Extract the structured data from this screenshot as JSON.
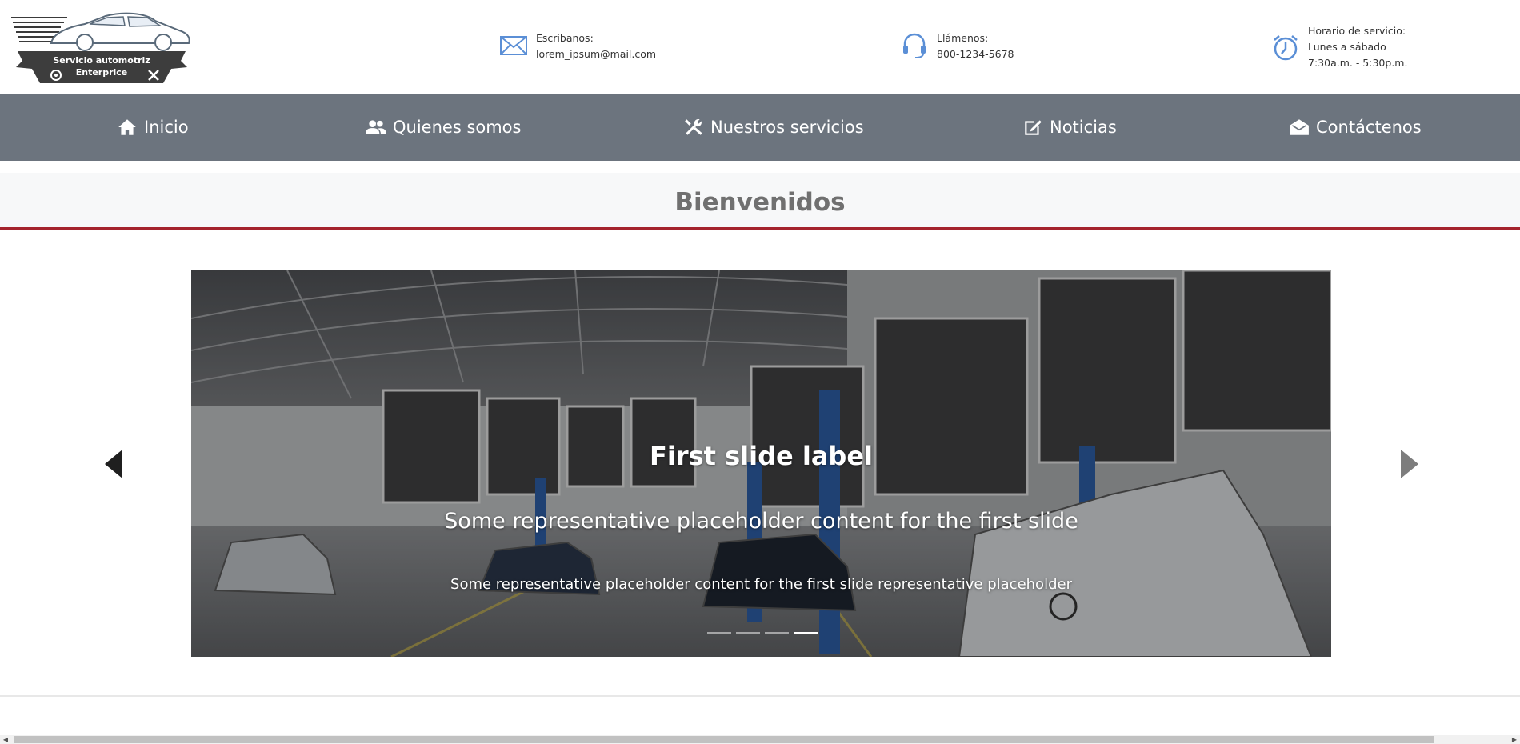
{
  "logo": {
    "line1": "Servicio automotriz",
    "line2": "Enterprice"
  },
  "contacts": {
    "mail": {
      "label": "Escribanos:",
      "value": "lorem_ipsum@mail.com",
      "icon": "envelope-icon"
    },
    "phone": {
      "label": "Llámenos:",
      "value": "800-1234-5678",
      "icon": "headset-icon"
    },
    "hours": {
      "label": "Horario de servicio:",
      "days": "Lunes a sábado",
      "time": "7:30a.m. - 5:30p.m.",
      "icon": "alarm-clock-icon"
    }
  },
  "nav": {
    "items": [
      {
        "label": "Inicio",
        "icon": "house-icon"
      },
      {
        "label": "Quienes somos",
        "icon": "people-icon"
      },
      {
        "label": "Nuestros servicios",
        "icon": "tools-icon"
      },
      {
        "label": "Noticias",
        "icon": "pencil-square-icon"
      },
      {
        "label": "Contáctenos",
        "icon": "envelope-open-icon"
      }
    ]
  },
  "welcome": {
    "title": "Bienvenidos"
  },
  "carousel": {
    "title": "First slide label",
    "subtitle": "Some representative placeholder content for the first slide",
    "text": "Some representative placeholder content for the first slide representative placeholder",
    "slides": 4,
    "active_index": 3
  },
  "colors": {
    "nav_bg": "#6c747e",
    "accent_line": "#a4232d",
    "icon_blue": "#5b8fd6",
    "welcome_text": "#707070"
  }
}
